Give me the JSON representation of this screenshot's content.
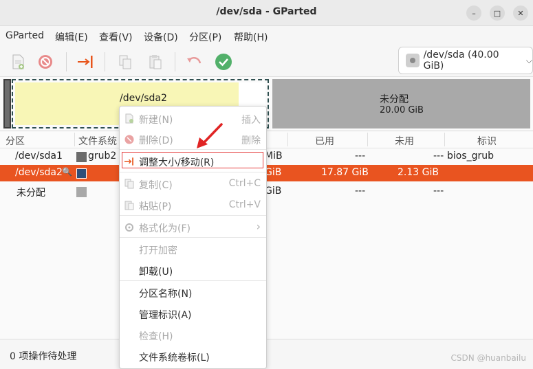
{
  "window": {
    "title": "/dev/sda - GParted",
    "minimize_glyph": "–",
    "maximize_glyph": "□",
    "close_glyph": "✕"
  },
  "menubar": [
    "GParted",
    "编辑(E)",
    "查看(V)",
    "设备(D)",
    "分区(P)",
    "帮助(H)"
  ],
  "toolbar": {
    "icons": [
      "new-partition-icon",
      "delete-icon",
      "resize-move-icon",
      "copy-icon",
      "paste-icon",
      "undo-icon",
      "apply-icon"
    ],
    "device_label": "/dev/sda (40.00 GiB)"
  },
  "diskmap": {
    "sda2_label": "/dev/sda2",
    "unallocated_label": "未分配",
    "unallocated_size": "20.00 GiB"
  },
  "columns": [
    "分区",
    "文件系统",
    "已用",
    "未用",
    "标识"
  ],
  "rows": [
    {
      "partition": "/dev/sda1",
      "filesystem": "grub2 c",
      "size_tail": "MiB",
      "used": "---",
      "unused": "---",
      "flags": "bios_grub",
      "fs_color": "#6b6b6b"
    },
    {
      "partition": "/dev/sda2",
      "filesystem": "",
      "size_tail": "GiB",
      "used": "17.87 GiB",
      "unused": "2.13 GiB",
      "flags": "",
      "fs_color": "#2f4f7a"
    },
    {
      "partition": "未分配",
      "filesystem": "",
      "size_tail": "GiB",
      "used": "---",
      "unused": "---",
      "flags": "",
      "fs_color": "#a8a8a8"
    }
  ],
  "context_menu": {
    "items": [
      {
        "label": "新建(N)",
        "accel": "插入"
      },
      {
        "label": "删除(D)",
        "accel": "删除"
      },
      {
        "label": "调整大小/移动(R)",
        "accel": ""
      },
      {
        "label": "复制(C)",
        "accel": "Ctrl+C"
      },
      {
        "label": "粘贴(P)",
        "accel": "Ctrl+V"
      },
      {
        "label": "格式化为(F)",
        "accel": "›"
      },
      {
        "label": "打开加密",
        "accel": ""
      },
      {
        "label": "卸载(U)",
        "accel": ""
      },
      {
        "label": "分区名称(N)",
        "accel": ""
      },
      {
        "label": "管理标识(A)",
        "accel": ""
      },
      {
        "label": "检查(H)",
        "accel": ""
      },
      {
        "label": "文件系统卷标(L)",
        "accel": ""
      }
    ]
  },
  "status": {
    "pending": "0 项操作待处理",
    "watermark": "CSDN @huanbailu"
  },
  "colors": {
    "selection": "#e95420",
    "sda2_fill": "#f8f6b6",
    "unallocated_fill": "#a9a9a9",
    "highlight": "#e53a3a"
  }
}
